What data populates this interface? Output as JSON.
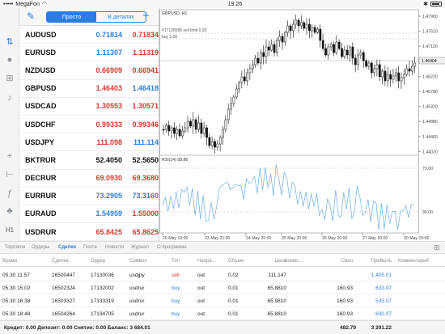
{
  "status_bar": {
    "carrier": "MegaFon",
    "time": "19:26"
  },
  "toolbar": {
    "simple_label": "Просто",
    "detailed_label": "В деталях"
  },
  "quotes": [
    {
      "symbol": "AUDUSD",
      "bid": "0.71814",
      "ask": "0.71834",
      "bid_color": "blue",
      "ask_color": "red"
    },
    {
      "symbol": "EURUSD",
      "bid": "1.11307",
      "ask": "1.11319",
      "bid_color": "blue",
      "ask_color": "red"
    },
    {
      "symbol": "NZDUSD",
      "bid": "0.66909",
      "ask": "0.66941",
      "bid_color": "red",
      "ask_color": "red"
    },
    {
      "symbol": "GBPUSD",
      "bid": "1.46403",
      "ask": "1.46418",
      "bid_color": "red",
      "ask_color": "blue"
    },
    {
      "symbol": "USDCAD",
      "bid": "1.30553",
      "ask": "1.30571",
      "bid_color": "red",
      "ask_color": "red"
    },
    {
      "symbol": "USDCHF",
      "bid": "0.99333",
      "ask": "0.99346",
      "bid_color": "red",
      "ask_color": "red"
    },
    {
      "symbol": "USDJPY",
      "bid": "111.098",
      "ask": "111.114",
      "bid_color": "red",
      "ask_color": "blue"
    },
    {
      "symbol": "BKTRUR",
      "bid": "52.4050",
      "ask": "52.5650",
      "bid_color": "black",
      "ask_color": "black"
    },
    {
      "symbol": "DECRUR",
      "bid": "69.0930",
      "ask": "69.3680",
      "bid_color": "red",
      "ask_color": "red"
    },
    {
      "symbol": "EURRUR",
      "bid": "73.2905",
      "ask": "73.3160",
      "bid_color": "blue",
      "ask_color": "blue"
    },
    {
      "symbol": "EURAUD",
      "bid": "1.54959",
      "ask": "1.55000",
      "bid_color": "blue",
      "ask_color": "red"
    },
    {
      "symbol": "USDRUR",
      "bid": "65.8425",
      "ask": "65.8625",
      "bid_color": "red",
      "ask_color": "red"
    }
  ],
  "chart": {
    "symbol_label": "GBPUSD, H1",
    "order_line_1": "#17135095 sell limit 0.20",
    "order_line_2": "buy 1.00",
    "current_price": "1.46404",
    "price_ticks": [
      "1.47900",
      "1.47510",
      "1.47120",
      "1.46660",
      "1.46220",
      "1.45780",
      "1.45320",
      "1.44880",
      "1.44460",
      "1.44020"
    ],
    "rsi_label": "RSI(14) 58.86",
    "rsi_ticks": [
      "70.00",
      "30.00"
    ],
    "time_ticks": [
      "20 May 19:00",
      "23 May 21:00",
      "24 May 20:00",
      "25 May 20:00",
      "26 May 20:00",
      "27 May 20:00",
      "30 May 19:00"
    ],
    "accent": "#2a7de1",
    "up_color": "#ffffff",
    "down_color": "#111111"
  },
  "bottom_tabs": [
    "Торговля",
    "Ордеры",
    "Сделки",
    "Почта",
    "Новости",
    "Журнал",
    "О программе"
  ],
  "active_tab_index": 2,
  "table": {
    "headers": [
      "Время",
      "Сделка",
      "Ордер",
      "Символ",
      "Тип",
      "Напра...",
      "Объем",
      "Цена",
      "Комис...",
      "Своп",
      "Прибыль",
      "Комментарий"
    ],
    "rows": [
      [
        "05.30 11:57",
        "16500447",
        "17130036",
        "usdjpy",
        "sell",
        "out",
        "0.02",
        "111.147",
        "",
        "",
        "1 405.01",
        ""
      ],
      [
        "05.30 15:02",
        "16502324",
        "17132002",
        "usdrur",
        "buy",
        "out",
        "0.01",
        "65.8810",
        "",
        "160.93",
        "633.07",
        ""
      ],
      [
        "05.30 16:38",
        "16503327",
        "17133319",
        "usdrur",
        "buy",
        "out",
        "0.01",
        "65.9810",
        "",
        "160.93",
        "533.07",
        ""
      ],
      [
        "05.30 18:48",
        "16504264",
        "17134705",
        "usdrur",
        "buy",
        "out",
        "0.01",
        "65.8810",
        "",
        "160.93",
        "630.07",
        ""
      ]
    ]
  },
  "footer": {
    "summary": "Кредит: 0.00 Депозит: 0.00 Снятие: 0.00 Баланс: 3 684.01",
    "swap_total": "482.79",
    "profit_total": "3 201.22"
  }
}
